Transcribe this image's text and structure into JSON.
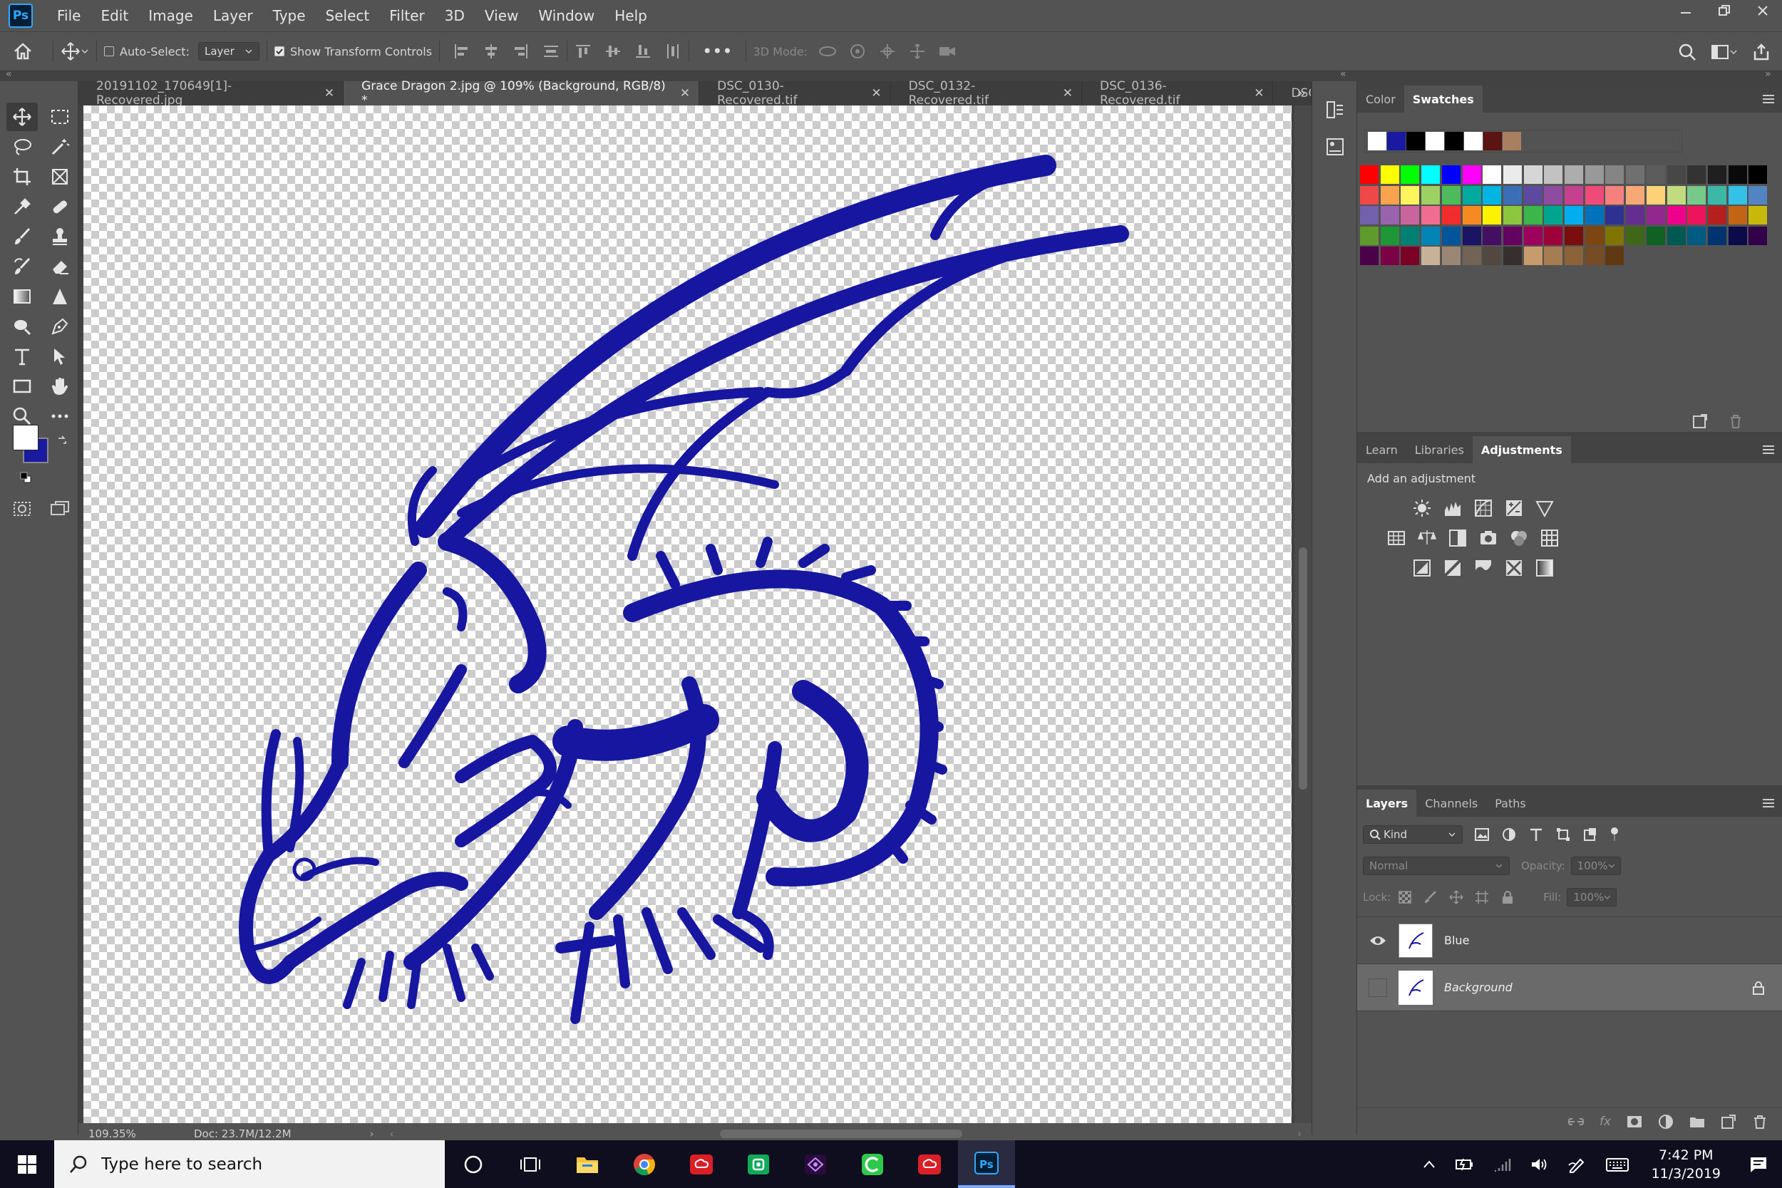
{
  "app": {
    "logo": "Ps"
  },
  "menu": [
    "File",
    "Edit",
    "Image",
    "Layer",
    "Type",
    "Select",
    "Filter",
    "3D",
    "View",
    "Window",
    "Help"
  ],
  "options": {
    "auto_select_label": "Auto-Select:",
    "auto_select_value": "Layer",
    "transform_label": "Show Transform Controls",
    "mode3d_label": "3D Mode:"
  },
  "tabs": [
    {
      "label": "20191102_170649[1]-Recovered.jpg",
      "active": false
    },
    {
      "label": "Grace Dragon 2.jpg @ 109% (Background, RGB/8) *",
      "active": true
    },
    {
      "label": "DSC_0130-Recovered.tif",
      "active": false
    },
    {
      "label": "DSC_0132-Recovered.tif",
      "active": false
    },
    {
      "label": "DSC_0136-Recovered.tif",
      "active": false
    },
    {
      "label": "DSC",
      "active": false
    }
  ],
  "status": {
    "zoom": "109.35%",
    "doc": "Doc: 23.7M/12.2M"
  },
  "colors": {
    "foreground": "#ffffff",
    "background": "#1a1aa0",
    "dragon": "#1616a0"
  },
  "panels": {
    "color_tabs": [
      "Color",
      "Swatches"
    ],
    "adj_tabs": [
      "Learn",
      "Libraries",
      "Adjustments"
    ],
    "adj_title": "Add an adjustment",
    "layer_tabs": [
      "Layers",
      "Channels",
      "Paths"
    ],
    "kind_label": "Kind",
    "blend_mode": "Normal",
    "opacity_label": "Opacity:",
    "opacity_value": "100%",
    "lock_label": "Lock:",
    "fill_label": "Fill:",
    "fill_value": "100%"
  },
  "recent_swatches": [
    "#ffffff",
    "#1a1aa0",
    "#000000",
    "#ffffff",
    "#000000",
    "#ffffff",
    "#5a1414",
    "#a88060"
  ],
  "swatch_rows": [
    [
      "#ff0000",
      "#ffff00",
      "#00ff00",
      "#00ffff",
      "#0000ff",
      "#ff00ff",
      "#ffffff",
      "#ebebeb",
      "#d6d6d6",
      "#c2c2c2",
      "#adadad",
      "#999999",
      "#858585",
      "#707070",
      "#5c5c5c",
      "#474747",
      "#333333",
      "#1f1f1f",
      "#0a0a0a",
      "#000000"
    ],
    [
      "#f04848",
      "#f9a34c",
      "#fff45b",
      "#9dd162",
      "#4dbb5a",
      "#00a99d",
      "#00b5e2",
      "#3a6fb8",
      "#5b4aa0",
      "#8e4ba0",
      "#c5418f",
      "#ee4b7a",
      "#f4817d",
      "#f6a877",
      "#fcd177",
      "#c1db7e",
      "#77c98a",
      "#3cb8a6",
      "#33c2e6",
      "#5283c2"
    ],
    [
      "#7260ad",
      "#9a63ad",
      "#ca649d",
      "#f06d8f",
      "#f22c2c",
      "#f58a23",
      "#fff200",
      "#8cc63f",
      "#3cb54a",
      "#00a58f",
      "#00aeef",
      "#0072bc",
      "#2e3192",
      "#662d91",
      "#92278f",
      "#ec008c",
      "#ed145b",
      "#b51f1f",
      "#c16414",
      "#c8b80a"
    ],
    [
      "#5f9a2d",
      "#1f9738",
      "#008073",
      "#0085b7",
      "#00559b",
      "#1b1464",
      "#440e62",
      "#630460",
      "#9e005d",
      "#9e0039",
      "#7a0d0d",
      "#7d4610",
      "#7f7500",
      "#406618",
      "#0f6124",
      "#005950",
      "#005b82",
      "#003471",
      "#0b0b4a",
      "#32004b"
    ],
    [
      "#4b0049",
      "#7b0046",
      "#7a0026",
      "#c7b299",
      "#998675",
      "#736357",
      "#534741",
      "#362f2d",
      "#c69c6d",
      "#a67c52",
      "#8c6239",
      "#754c24",
      "#603913"
    ]
  ],
  "layers": [
    {
      "name": "Blue",
      "visible": true,
      "selected": false
    },
    {
      "name": "Background",
      "visible": false,
      "selected": true,
      "locked": true
    }
  ],
  "taskbar": {
    "search_placeholder": "Type here to search",
    "time": "7:42 PM",
    "date": "11/3/2019"
  }
}
